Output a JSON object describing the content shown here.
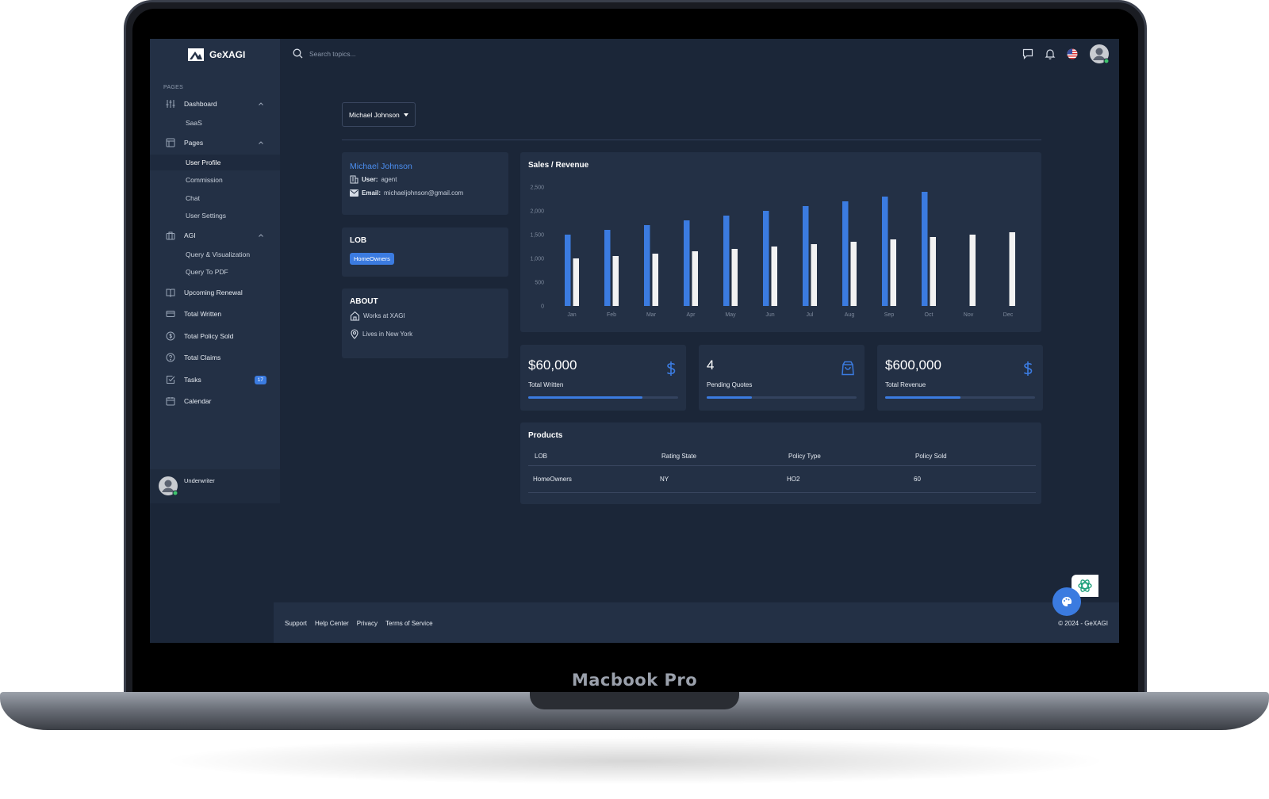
{
  "device": {
    "label": "Macbook Pro"
  },
  "app": {
    "name": "GeXAGI"
  },
  "sidebar": {
    "section": "PAGES",
    "items": [
      {
        "label": "Dashboard",
        "icon": "sliders-icon",
        "children": [
          "SaaS"
        ]
      },
      {
        "label": "Pages",
        "icon": "layout-icon",
        "children": [
          "User Profile",
          "Commission",
          "Chat",
          "User Settings"
        ],
        "active_child": "User Profile"
      },
      {
        "label": "AGI",
        "icon": "briefcase-icon",
        "children": [
          "Query & Visualization",
          "Query To PDF"
        ]
      },
      {
        "label": "Upcoming Renewal",
        "icon": "book-icon"
      },
      {
        "label": "Total Written",
        "icon": "card-icon"
      },
      {
        "label": "Total Policy Sold",
        "icon": "dollar-circle-icon"
      },
      {
        "label": "Total Claims",
        "icon": "help-circle-icon"
      },
      {
        "label": "Tasks",
        "icon": "check-square-icon",
        "badge": "17"
      },
      {
        "label": "Calendar",
        "icon": "calendar-icon"
      }
    ],
    "user_role": "Underwriter"
  },
  "topbar": {
    "search_placeholder": "Search topics..."
  },
  "content": {
    "user_select": "Michael Johnson",
    "profile": {
      "name": "Michael Johnson",
      "user_label": "User:",
      "user_value": "agent",
      "email_label": "Email:",
      "email_value": "michaeljohnson@gmail.com"
    },
    "lob": {
      "title": "LOB",
      "tag": "HomeOwners"
    },
    "about": {
      "title": "ABOUT",
      "work": "Works at XAGI",
      "location": "Lives in New York"
    },
    "stats": [
      {
        "value": "$60,000",
        "label": "Total Written",
        "progress": 0.76,
        "icon": "dollar-icon"
      },
      {
        "value": "4",
        "label": "Pending Quotes",
        "progress": 0.3,
        "icon": "shopping-bag-icon"
      },
      {
        "value": "$600,000",
        "label": "Total Revenue",
        "progress": 0.5,
        "icon": "dollar-icon"
      }
    ],
    "products": {
      "title": "Products",
      "columns": [
        "LOB",
        "Rating State",
        "Policy Type",
        "Policy Sold"
      ],
      "rows": [
        [
          "HomeOwners",
          "NY",
          "HO2",
          "60"
        ]
      ]
    }
  },
  "chart_data": {
    "type": "bar",
    "title": "Sales / Revenue",
    "categories": [
      "Jan",
      "Feb",
      "Mar",
      "Apr",
      "May",
      "Jun",
      "Jul",
      "Aug",
      "Sep",
      "Oct",
      "Nov",
      "Dec"
    ],
    "series": [
      {
        "values": [
          1500,
          1600,
          1700,
          1800,
          1900,
          2000,
          2100,
          2200,
          2300,
          2400,
          null,
          null
        ],
        "color": "#3b7be0"
      },
      {
        "values": [
          1000,
          1050,
          1100,
          1150,
          1200,
          1250,
          1300,
          1350,
          1400,
          1450,
          1500,
          1550
        ],
        "color": "#f2f2f2"
      }
    ],
    "yticks": [
      0,
      500,
      1000,
      1500,
      2000,
      2500
    ],
    "yticklabels": [
      "0",
      "500",
      "1,000",
      "1,500",
      "2,000",
      "2,500"
    ],
    "ylim": [
      0,
      2500
    ],
    "grid": false,
    "legend": "none"
  },
  "footer": {
    "links": [
      "Support",
      "Help Center",
      "Privacy",
      "Terms of Service"
    ],
    "copyright": "© 2024 - GeXAGI"
  },
  "colors": {
    "accent": "#3b7be0",
    "bg": "#1b2638",
    "panel": "#233045",
    "online": "#3ec46d"
  }
}
